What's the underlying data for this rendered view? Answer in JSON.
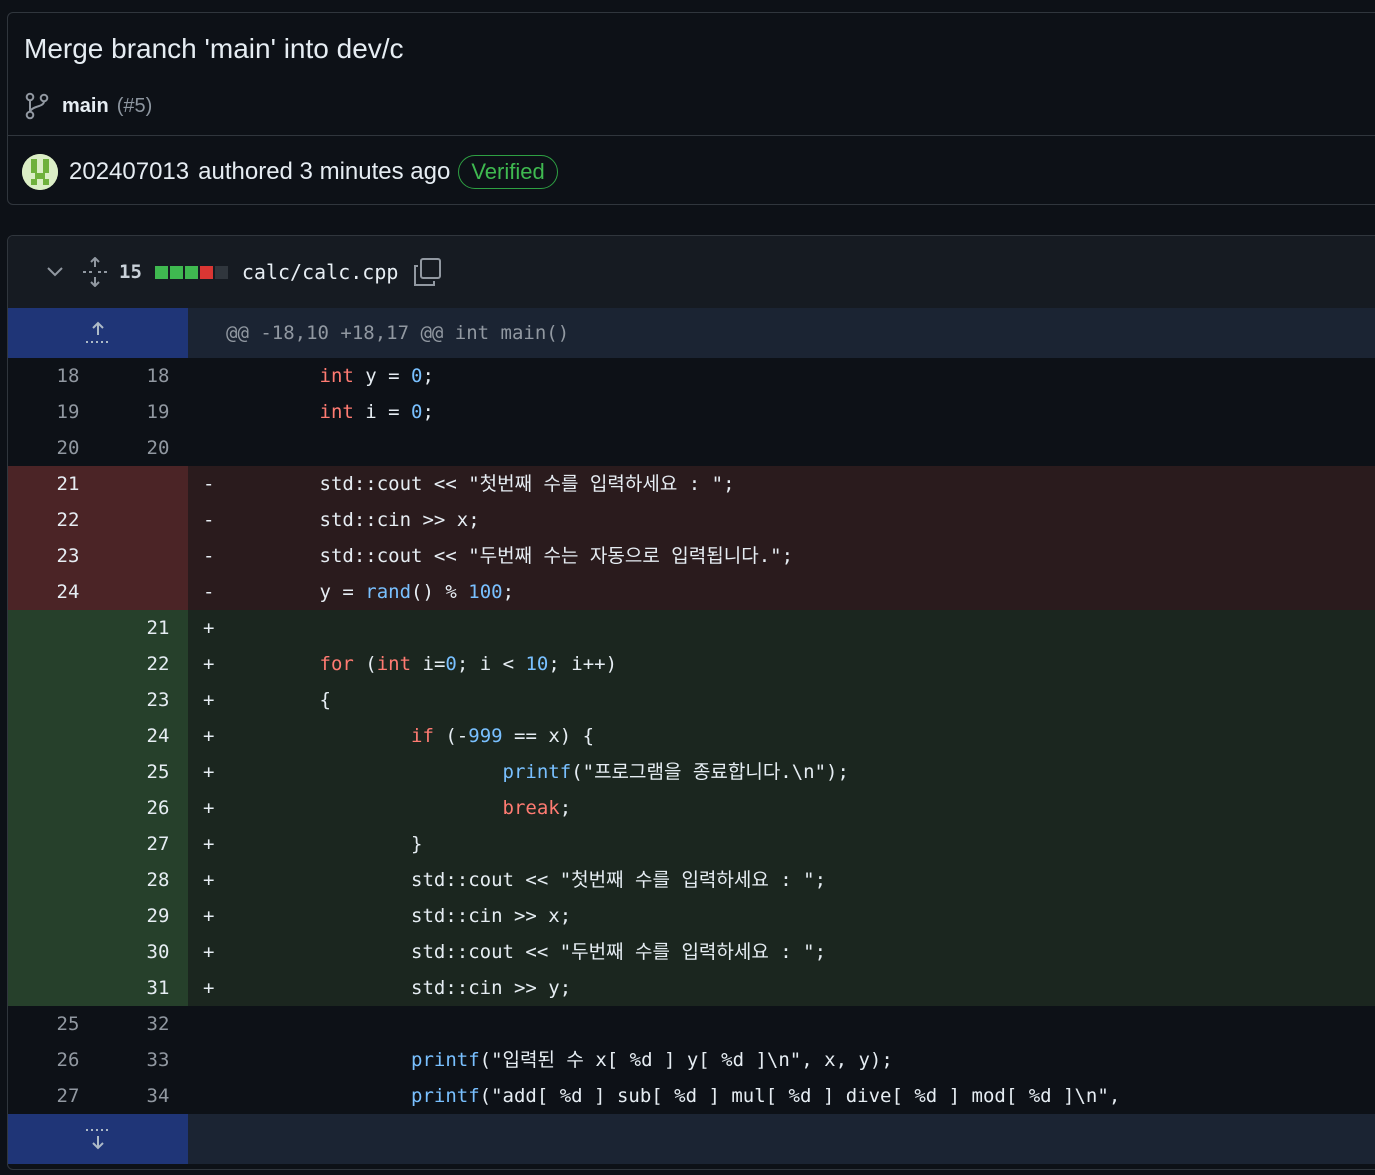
{
  "commit": {
    "title": "Merge branch 'main' into dev/c",
    "branch": "main",
    "pr": "(#5)",
    "author": "202407013",
    "meta": "authored 3 minutes ago",
    "verified": "Verified"
  },
  "file": {
    "change_count": "15",
    "path": "calc/calc.cpp",
    "diffstat_colors": [
      "#3fb950",
      "#3fb950",
      "#3fb950",
      "#da3633",
      "#30363d"
    ]
  },
  "hunk": {
    "header": "@@ -18,10 +18,17 @@ int main()"
  },
  "lines": [
    {
      "type": "ctx",
      "old": "18",
      "new": "18",
      "sign": "",
      "code": [
        [
          "        ",
          ""
        ],
        [
          "int",
          "kw"
        ],
        [
          " y = ",
          ""
        ],
        [
          "0",
          "nm"
        ],
        [
          ";",
          ""
        ]
      ]
    },
    {
      "type": "ctx",
      "old": "19",
      "new": "19",
      "sign": "",
      "code": [
        [
          "        ",
          ""
        ],
        [
          "int",
          "kw"
        ],
        [
          " i = ",
          ""
        ],
        [
          "0",
          "nm"
        ],
        [
          ";",
          ""
        ]
      ]
    },
    {
      "type": "ctx",
      "old": "20",
      "new": "20",
      "sign": "",
      "code": []
    },
    {
      "type": "del",
      "old": "21",
      "new": "",
      "sign": "-",
      "code": [
        [
          "        std::cout << \"첫번째 수를 입력하세요 : \";",
          ""
        ]
      ]
    },
    {
      "type": "del",
      "old": "22",
      "new": "",
      "sign": "-",
      "code": [
        [
          "        std::cin >> x;",
          ""
        ]
      ]
    },
    {
      "type": "del",
      "old": "23",
      "new": "",
      "sign": "-",
      "code": [
        [
          "        std::cout << \"두번째 수는 자동으로 입력됩니다.\";",
          ""
        ]
      ]
    },
    {
      "type": "del",
      "old": "24",
      "new": "",
      "sign": "-",
      "code": [
        [
          "        y = ",
          ""
        ],
        [
          "rand",
          "fn"
        ],
        [
          "() % ",
          ""
        ],
        [
          "100",
          "nm"
        ],
        [
          ";",
          ""
        ]
      ]
    },
    {
      "type": "add",
      "old": "",
      "new": "21",
      "sign": "+",
      "code": []
    },
    {
      "type": "add",
      "old": "",
      "new": "22",
      "sign": "+",
      "code": [
        [
          "        ",
          ""
        ],
        [
          "for",
          "kw"
        ],
        [
          " (",
          ""
        ],
        [
          "int",
          "kw"
        ],
        [
          " i=",
          ""
        ],
        [
          "0",
          "nm"
        ],
        [
          "; i < ",
          ""
        ],
        [
          "10",
          "nm"
        ],
        [
          "; i++)",
          ""
        ]
      ]
    },
    {
      "type": "add",
      "old": "",
      "new": "23",
      "sign": "+",
      "code": [
        [
          "        {",
          ""
        ]
      ]
    },
    {
      "type": "add",
      "old": "",
      "new": "24",
      "sign": "+",
      "code": [
        [
          "                ",
          ""
        ],
        [
          "if",
          "kw"
        ],
        [
          " (-",
          ""
        ],
        [
          "999",
          "nm"
        ],
        [
          " == x) {",
          ""
        ]
      ]
    },
    {
      "type": "add",
      "old": "",
      "new": "25",
      "sign": "+",
      "code": [
        [
          "                        ",
          ""
        ],
        [
          "printf",
          "fn"
        ],
        [
          "(\"프로그램을 종료합니다.\\n\");",
          ""
        ]
      ]
    },
    {
      "type": "add",
      "old": "",
      "new": "26",
      "sign": "+",
      "code": [
        [
          "                        ",
          ""
        ],
        [
          "break",
          "kw"
        ],
        [
          ";",
          ""
        ]
      ]
    },
    {
      "type": "add",
      "old": "",
      "new": "27",
      "sign": "+",
      "code": [
        [
          "                }",
          ""
        ]
      ]
    },
    {
      "type": "add",
      "old": "",
      "new": "28",
      "sign": "+",
      "code": [
        [
          "                std::cout << \"첫번째 수를 입력하세요 : \";",
          ""
        ]
      ]
    },
    {
      "type": "add",
      "old": "",
      "new": "29",
      "sign": "+",
      "code": [
        [
          "                std::cin >> x;",
          ""
        ]
      ]
    },
    {
      "type": "add",
      "old": "",
      "new": "30",
      "sign": "+",
      "code": [
        [
          "                std::cout << \"두번째 수를 입력하세요 : \";",
          ""
        ]
      ]
    },
    {
      "type": "add",
      "old": "",
      "new": "31",
      "sign": "+",
      "code": [
        [
          "                std::cin >> y;",
          ""
        ]
      ]
    },
    {
      "type": "ctx",
      "old": "25",
      "new": "32",
      "sign": "",
      "code": []
    },
    {
      "type": "ctx",
      "old": "26",
      "new": "33",
      "sign": "",
      "code": [
        [
          "                ",
          ""
        ],
        [
          "printf",
          "fn"
        ],
        [
          "(\"입력된 수 x[ %d ] y[ %d ]\\n\", x, y);",
          ""
        ]
      ]
    },
    {
      "type": "ctx",
      "old": "27",
      "new": "34",
      "sign": "",
      "code": [
        [
          "                ",
          ""
        ],
        [
          "printf",
          "fn"
        ],
        [
          "(\"add[ %d ] sub[ %d ] mul[ %d ] dive[ %d ] mod[ %d ]\\n\",",
          ""
        ]
      ]
    }
  ],
  "icons": {
    "branch": "git-branch-icon",
    "chevron": "chevron-down-icon",
    "expand_all": "unfold-icon",
    "copy": "copy-icon",
    "expand_up": "expand-up-icon",
    "expand_down": "expand-down-icon"
  }
}
